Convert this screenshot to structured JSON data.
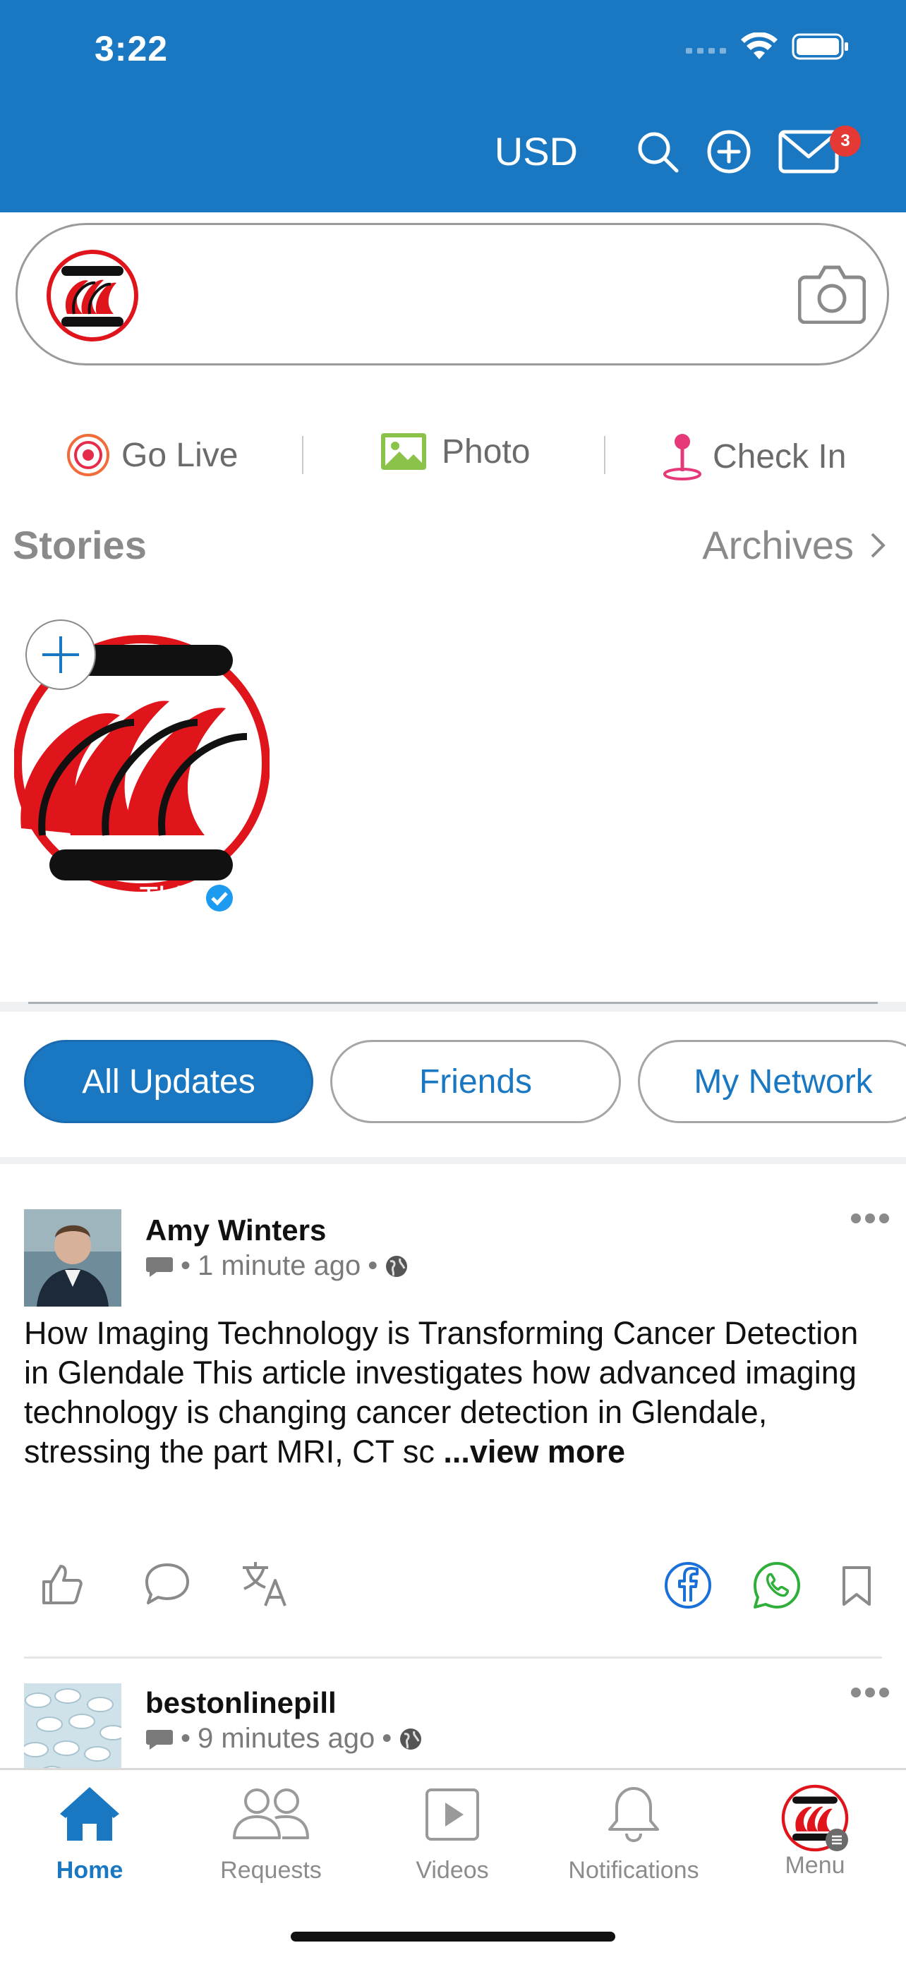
{
  "status_bar": {
    "time": "3:22"
  },
  "header": {
    "currency": "USD",
    "messages_badge": "3",
    "brand_color": "#1a78c2"
  },
  "composer": {
    "camera_icon": "camera-icon"
  },
  "quick_actions": {
    "go_live": "Go Live",
    "photo": "Photo",
    "check_in": "Check In"
  },
  "stories": {
    "title": "Stories",
    "archives": "Archives",
    "items": [
      {
        "name": "UniqueThis"
      }
    ]
  },
  "filters": {
    "tabs": [
      {
        "label": "All Updates",
        "active": true
      },
      {
        "label": "Friends",
        "active": false
      },
      {
        "label": "My Network",
        "active": false
      }
    ]
  },
  "posts": [
    {
      "author": "Amy Winters",
      "time": "1 minute ago",
      "text": "How Imaging Technology is Transforming Cancer Detection in Glendale This article investigates how advanced imaging technology is changing cancer detection in Glendale, stressing the part MRI, CT sc",
      "view_more": "...view more"
    },
    {
      "author": "bestonlinepill",
      "time": "9 minutes ago"
    }
  ],
  "bottom_nav": {
    "items": [
      {
        "label": "Home",
        "active": true
      },
      {
        "label": "Requests",
        "active": false
      },
      {
        "label": "Videos",
        "active": false
      },
      {
        "label": "Notifications",
        "active": false
      },
      {
        "label": "Menu",
        "active": false
      }
    ]
  }
}
